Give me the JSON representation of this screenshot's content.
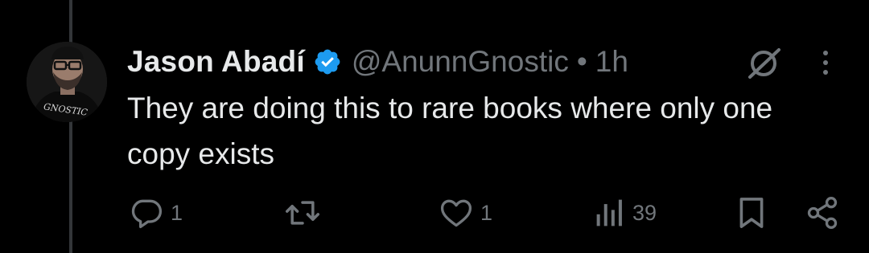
{
  "tweet": {
    "author": {
      "display_name": "Jason Abadí",
      "handle": "@AnunnGnostic",
      "verified": true,
      "avatar_shirt_text": "GNOSTIC"
    },
    "separator": "•",
    "timestamp": "1h",
    "text": "They are doing this to rare books where only one copy exists",
    "actions": {
      "reply_count": "1",
      "retweet_count": "",
      "like_count": "1",
      "view_count": "39"
    }
  },
  "icons": {
    "verified": "verified-badge-icon",
    "grok": "grok-icon",
    "more": "more-vertical-icon",
    "reply": "reply-icon",
    "retweet": "retweet-icon",
    "like": "heart-icon",
    "views": "views-icon",
    "bookmark": "bookmark-icon",
    "share": "share-icon"
  },
  "colors": {
    "background": "#000000",
    "primary_text": "#e7e9ea",
    "secondary_text": "#71767b",
    "verified_blue": "#1d9bf0",
    "thread_line": "#333639"
  }
}
